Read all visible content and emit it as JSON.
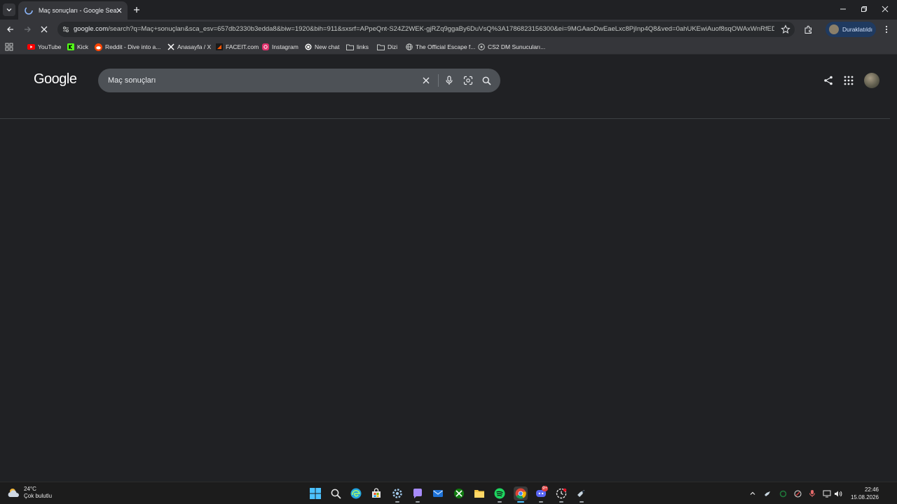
{
  "window": {
    "tab_title": "Maç sonuçları - Google Search"
  },
  "toolbar": {
    "url_host": "google.com",
    "url_path": "/search?q=Maç+sonuçları&sca_esv=657db2330b3edda8&biw=1920&bih=911&sxsrf=APpeQnt-S24Z2WEK-gjRZq9ggaBy6DuVsQ%3A1786823156300&ei=9MGAaoDwEaeLxc8PjInp4Q8&ved=0ahUKEwiAuof8sqOWAxWnRfEDHYxE...",
    "profile_label": "Duraklatıldı"
  },
  "bookmarks": [
    {
      "label": "YouTube",
      "icon": "youtube-icon",
      "color": "#ff0000"
    },
    {
      "label": "Kick",
      "icon": "kick-icon",
      "color": "#53fc18"
    },
    {
      "label": "Reddit - Dive into a...",
      "icon": "reddit-icon",
      "color": "#ff4500"
    },
    {
      "label": "Anasayfa / X",
      "icon": "x-icon",
      "color": "#ffffff"
    },
    {
      "label": "FACEIT.com",
      "icon": "faceit-icon",
      "color": "#ff5500"
    },
    {
      "label": "Instagram",
      "icon": "instagram-icon",
      "color": "#e1306c"
    },
    {
      "label": "New chat",
      "icon": "chatgpt-icon",
      "color": "#ffffff"
    },
    {
      "label": "links",
      "icon": "folder-icon",
      "color": "#c4c7c5"
    },
    {
      "label": "Dizi",
      "icon": "folder-icon",
      "color": "#c4c7c5"
    },
    {
      "label": "The Official Escape f...",
      "icon": "globe-icon",
      "color": "#c4c7c5"
    },
    {
      "label": "CS2 DM Sunucuları...",
      "icon": "cs2-icon",
      "color": "#c4c7c5"
    }
  ],
  "google": {
    "logo": "Google",
    "query": "Maç sonuçları"
  },
  "taskbar": {
    "temperature": "24°C",
    "weather_desc": "Çok bulutlu",
    "time": "22:46",
    "date": "15.08.2026",
    "notification_badge": "9+"
  },
  "colors": {
    "page_bg": "#202124",
    "toolbar_bg": "#35363a",
    "searchbox_bg": "#4d5156",
    "taskbar_bg": "#1c1c1c"
  }
}
